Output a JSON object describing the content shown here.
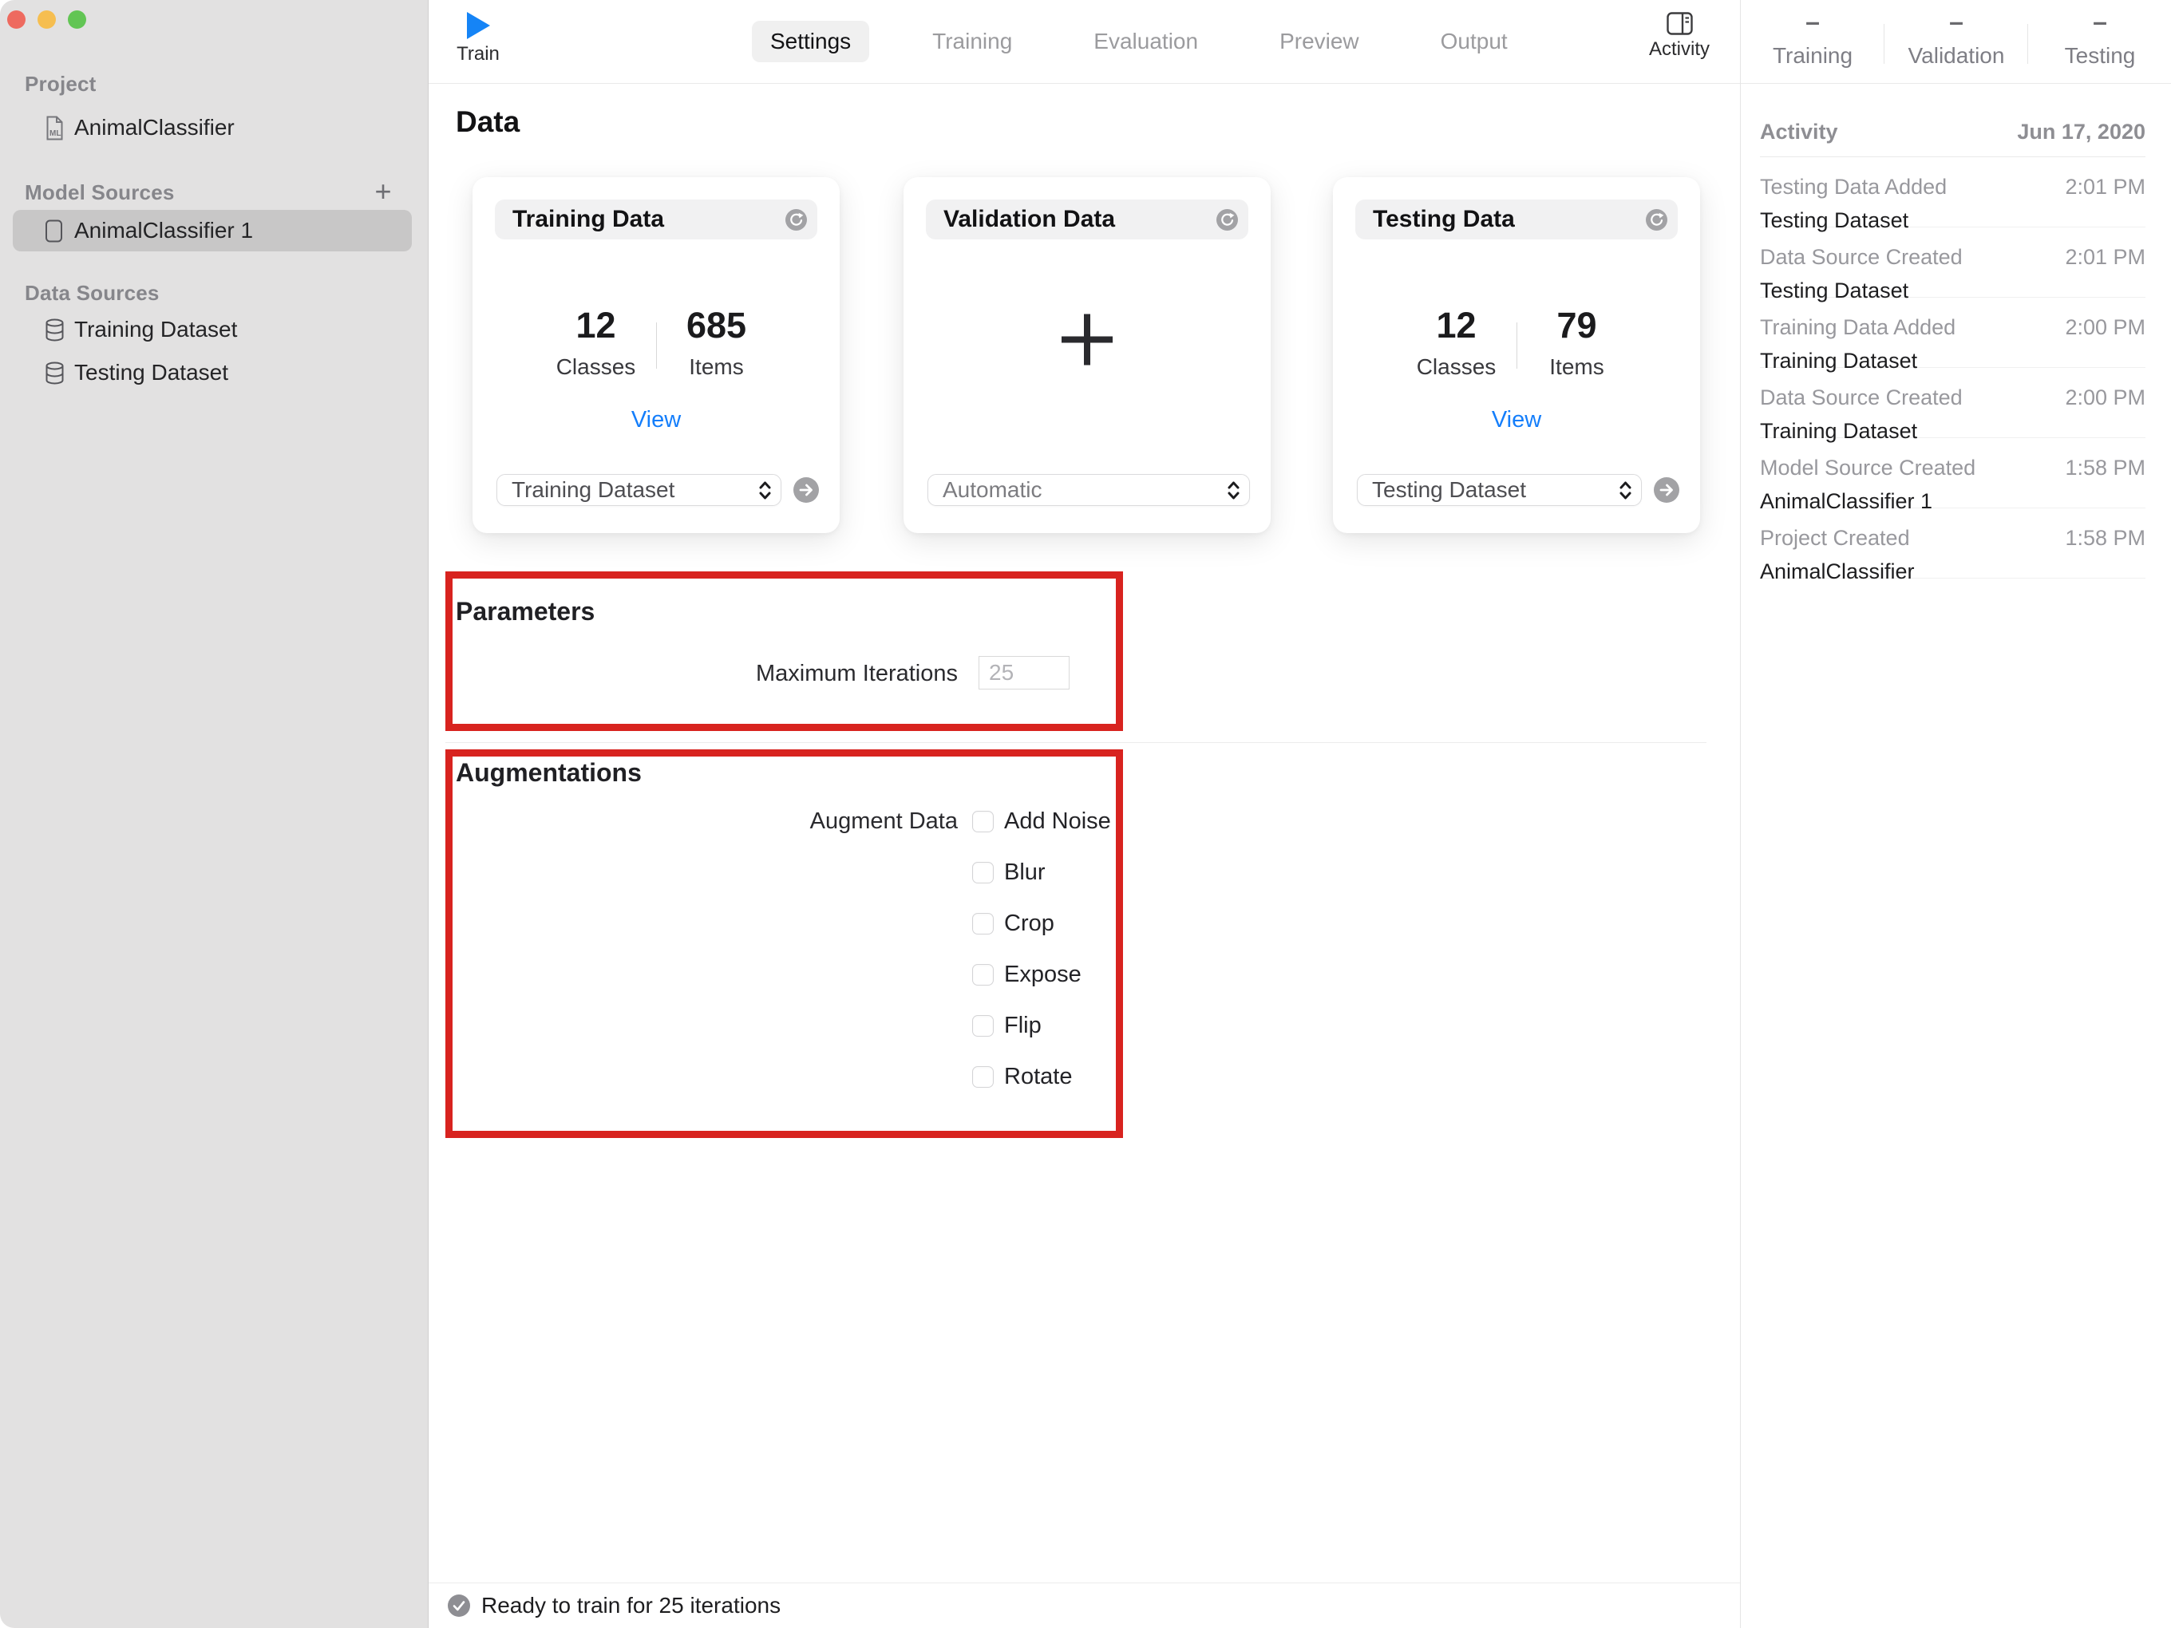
{
  "colors": {
    "accent_blue": "#1584F6",
    "link_blue": "#147EFB",
    "annotation_red": "#D8231F",
    "sidebar_bg": "#E2E1E1",
    "selection_gray": "#C8C7C7",
    "traffic_red": "#EE6A5F",
    "traffic_yellow": "#F6BE50",
    "traffic_green": "#62C554"
  },
  "sidebar": {
    "project_header": "Project",
    "project_item": "AnimalClassifier",
    "model_sources_header": "Model Sources",
    "add_button": "+",
    "model_item": "AnimalClassifier 1",
    "data_sources_header": "Data Sources",
    "data_items": [
      "Training Dataset",
      "Testing Dataset"
    ]
  },
  "toolbar": {
    "train_label": "Train",
    "tabs": [
      {
        "label": "Settings",
        "active": true
      },
      {
        "label": "Training",
        "active": false
      },
      {
        "label": "Evaluation",
        "active": false
      },
      {
        "label": "Preview",
        "active": false
      },
      {
        "label": "Output",
        "active": false
      }
    ],
    "activity_label": "Activity"
  },
  "content": {
    "heading": "Data",
    "cards": [
      {
        "title": "Training Data",
        "classes_value": "12",
        "classes_label": "Classes",
        "items_value": "685",
        "items_label": "Items",
        "view_label": "View",
        "dropdown_value": "Training Dataset"
      },
      {
        "title": "Validation Data",
        "empty_icon": "plus",
        "dropdown_value": "Automatic"
      },
      {
        "title": "Testing Data",
        "classes_value": "12",
        "classes_label": "Classes",
        "items_value": "79",
        "items_label": "Items",
        "view_label": "View",
        "dropdown_value": "Testing Dataset"
      }
    ],
    "parameters": {
      "heading": "Parameters",
      "max_iterations_label": "Maximum Iterations",
      "max_iterations_value": "25"
    },
    "augmentations": {
      "heading": "Augmentations",
      "row_label": "Augment Data",
      "options": [
        "Add Noise",
        "Blur",
        "Crop",
        "Expose",
        "Flip",
        "Rotate"
      ],
      "checked": [
        false,
        false,
        false,
        false,
        false,
        false
      ]
    },
    "status_text": "Ready to train for 25 iterations"
  },
  "right_panel": {
    "stats": [
      {
        "value": "–",
        "label": "Training"
      },
      {
        "value": "–",
        "label": "Validation"
      },
      {
        "value": "–",
        "label": "Testing"
      }
    ],
    "activity_header": "Activity",
    "activity_date": "Jun 17, 2020",
    "entries": [
      {
        "title": "Testing Data Added",
        "time": "2:01 PM",
        "subtitle": "Testing Dataset"
      },
      {
        "title": "Data Source Created",
        "time": "2:01 PM",
        "subtitle": "Testing Dataset"
      },
      {
        "title": "Training Data Added",
        "time": "2:00 PM",
        "subtitle": "Training Dataset"
      },
      {
        "title": "Data Source Created",
        "time": "2:00 PM",
        "subtitle": "Training Dataset"
      },
      {
        "title": "Model Source Created",
        "time": "1:58 PM",
        "subtitle": "AnimalClassifier 1"
      },
      {
        "title": "Project Created",
        "time": "1:58 PM",
        "subtitle": "AnimalClassifier"
      }
    ]
  }
}
